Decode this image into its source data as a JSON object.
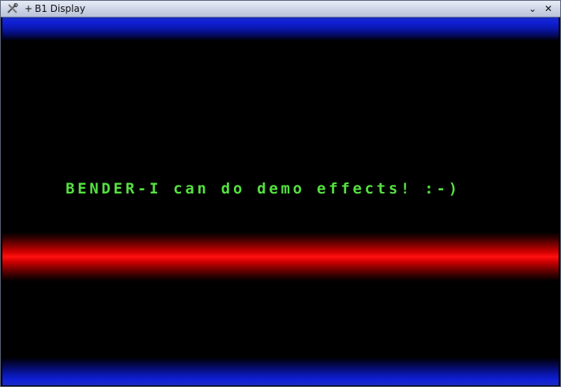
{
  "window": {
    "title": "B1 Display",
    "pin_glyph": "+",
    "icons": {
      "app": "tools-icon",
      "minimize": "minimize-icon",
      "close": "close-icon"
    },
    "minimize_glyph": "⌄",
    "close_glyph": "✕"
  },
  "display": {
    "message": "BENDER-I can do demo effects! :-)",
    "colors": {
      "background": "#000000",
      "text": "#55e040",
      "top_bar": "#1020d8",
      "middle_bar": "#ff1010",
      "bottom_bar": "#1020d8"
    }
  }
}
